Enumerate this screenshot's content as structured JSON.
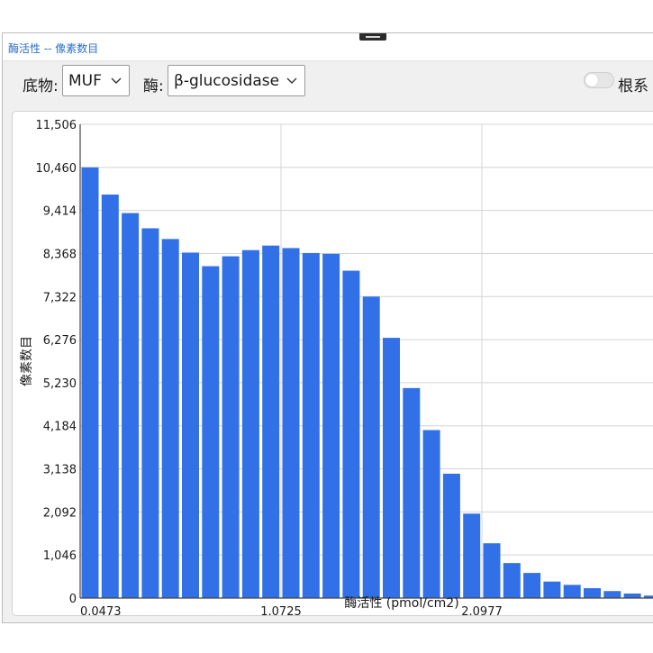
{
  "window": {
    "title": "酶活性 -- 像素数目"
  },
  "toolbar": {
    "substrate_label": "底物:",
    "substrate_value": "MUF",
    "enzyme_label": "酶:",
    "enzyme_value": "β-glucosidase",
    "root_toggle_label": "根系",
    "root_toggle_on": false
  },
  "icons": {
    "dropdown": "chevron-down-icon",
    "toggle": "toggle-switch-icon"
  },
  "colors": {
    "bar": "#3270e8",
    "title": "#2b6fc9",
    "grid": "#d4d4d4"
  },
  "chart_data": {
    "type": "bar",
    "xlabel": "酶活性 (pmol/cm2)",
    "ylabel": "像素数目",
    "xticks": [
      "0.0473",
      "1.0725",
      "2.0977"
    ],
    "xtick_bins": [
      0,
      10,
      20
    ],
    "yticks": [
      "0",
      "1,046",
      "2,092",
      "3,138",
      "4,184",
      "5,230",
      "6,276",
      "7,322",
      "8,368",
      "9,414",
      "10,460",
      "11,506"
    ],
    "ylim": [
      0,
      11506
    ],
    "y_step": 1046,
    "grid": true,
    "values": [
      10460,
      9800,
      9350,
      8980,
      8720,
      8390,
      8060,
      8300,
      8450,
      8560,
      8500,
      8380,
      8360,
      7950,
      7322,
      6320,
      5100,
      4080,
      3020,
      2050,
      1330,
      850,
      610,
      400,
      320,
      240,
      170,
      110,
      60
    ]
  }
}
